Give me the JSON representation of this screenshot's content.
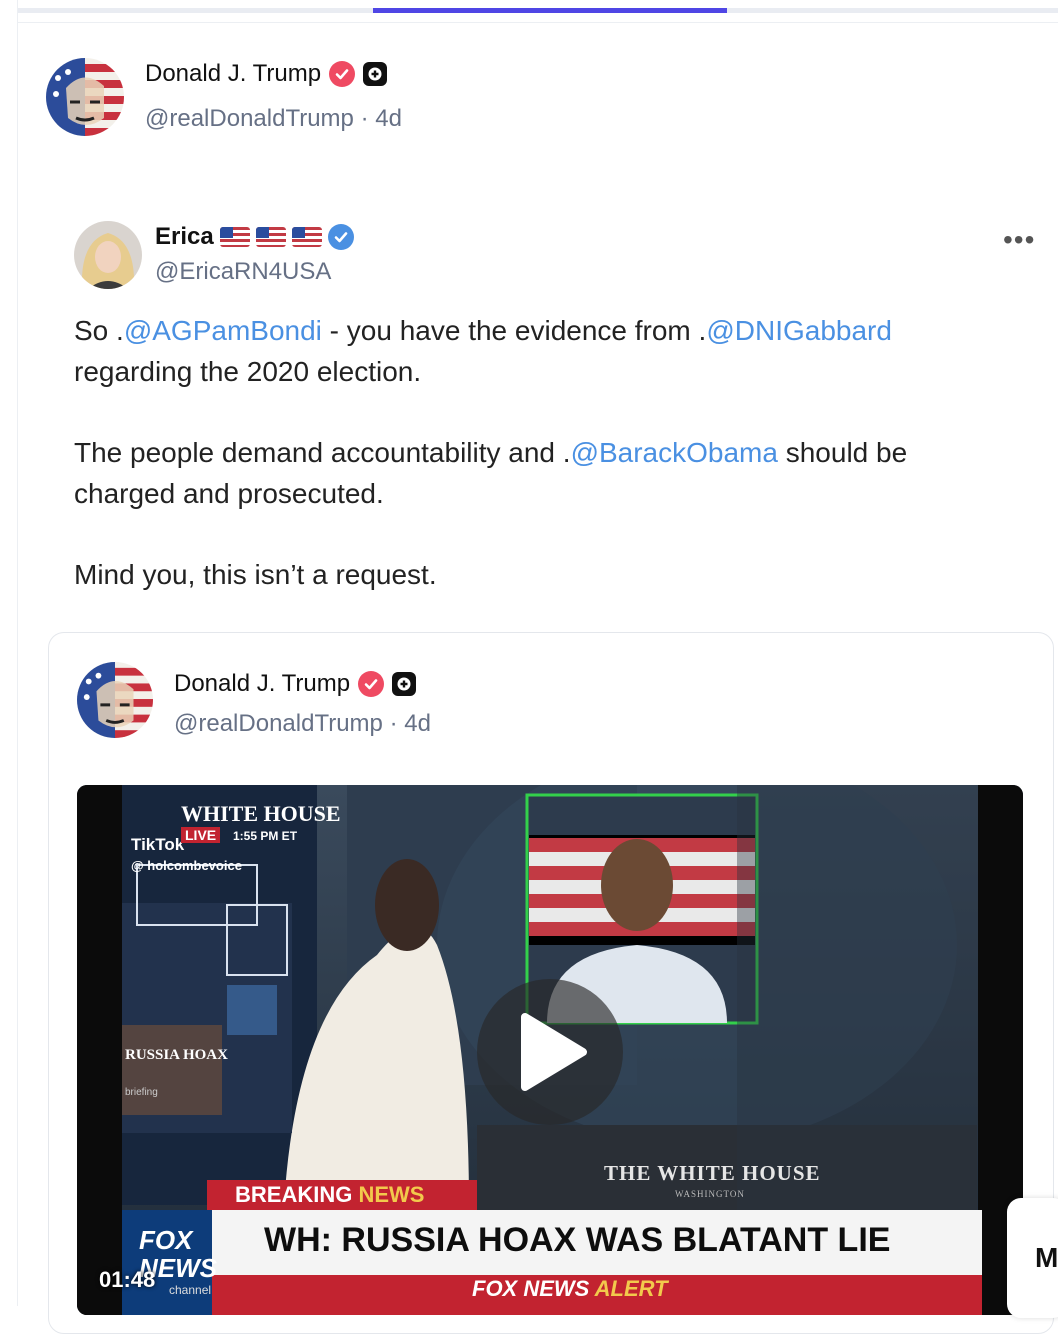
{
  "progress": {
    "fraction": 0.34,
    "accent": "#4f46e5"
  },
  "post": {
    "author": {
      "name": "Donald J. Trump",
      "handle": "@realDonaldTrump",
      "time": "4d"
    }
  },
  "quote": {
    "author": {
      "name": "Erica",
      "handle": "@EricaRN4USA",
      "flags": [
        "us-flag",
        "us-flag",
        "us-flag"
      ]
    },
    "more_label": "•••",
    "paragraphs": [
      [
        {
          "t": "So ."
        },
        {
          "t": "@AGPamBondi",
          "m": true
        },
        {
          "t": "  - you have the evidence from ."
        },
        {
          "t": "@DNIGabbard",
          "m": true
        },
        {
          "t": " regarding the 2020 election."
        }
      ],
      [
        {
          "t": "The people demand accountability and ."
        },
        {
          "t": "@BarackObama",
          "m": true
        },
        {
          "t": " should be charged and prosecuted."
        }
      ],
      [
        {
          "t": "Mind you, this isn’t a request."
        }
      ]
    ],
    "mention_color": "#4a90e2"
  },
  "embedded": {
    "author": {
      "name": "Donald J. Trump",
      "handle": "@realDonaldTrump",
      "time": "4d"
    },
    "video": {
      "duration": "01:48",
      "overlay": {
        "tiktok": "TikTok",
        "tiktok_user": "@ holcombevoice",
        "banner_top": "WHITE HOUSE",
        "live": "LIVE",
        "time": "1:55 PM ET",
        "breaking": "BREAKING",
        "news": "NEWS",
        "headline": "WH: RUSSIA HOAX WAS BLATANT LIE",
        "alert_a": "FOX NEWS",
        "alert_b": "ALERT",
        "podium": "THE WHITE HOUSE",
        "podium_sub": "WASHINGTON",
        "network_top": "FOX",
        "network_bottom": "NEWS",
        "channel": "channel",
        "board_label": "RUSSIA HOAX",
        "board_sub": "briefing"
      }
    }
  },
  "side": {
    "letter": "M"
  }
}
